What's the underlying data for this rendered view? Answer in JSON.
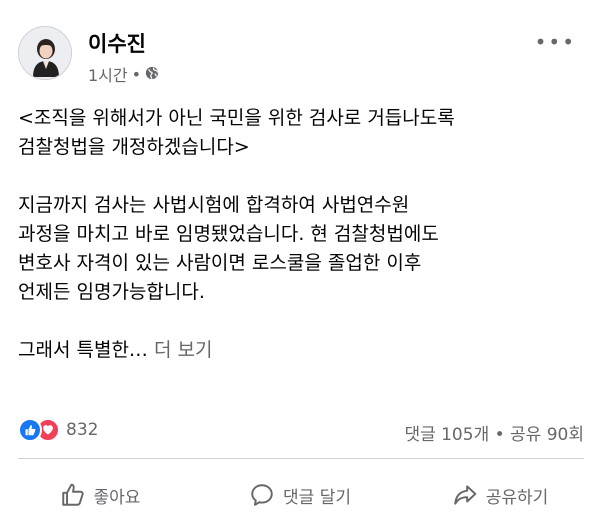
{
  "post": {
    "author": "이수진",
    "time": "1시간",
    "separator": "•",
    "audience_icon": "globe-icon",
    "more_icon": "more-options-icon",
    "more_label": "•••",
    "paragraph_1": "<조직을 위해서가 아닌 국민을 위한 검사로 거듭나도록\n검찰청법을 개정하겠습니다>",
    "paragraph_2": "지금까지 검사는 사법시험에 합격하여 사법연수원\n과정을 마치고 바로 임명됐었습니다. 현 검찰청법에도\n변호사 자격이 있는 사람이면 로스쿨을 졸업한 이후\n언제든 임명가능합니다.",
    "paragraph_3": "그래서 특별한…",
    "see_more": "더 보기"
  },
  "stats": {
    "reactions": [
      "like",
      "love"
    ],
    "reaction_count": "832",
    "comments_shares": "댓글 105개 • 공유 90회"
  },
  "actions": {
    "like": "좋아요",
    "comment": "댓글 달기",
    "share": "공유하기"
  },
  "colors": {
    "like_blue": "#1877f2",
    "love_red": "#f33e58",
    "secondary_text": "#65676b"
  }
}
